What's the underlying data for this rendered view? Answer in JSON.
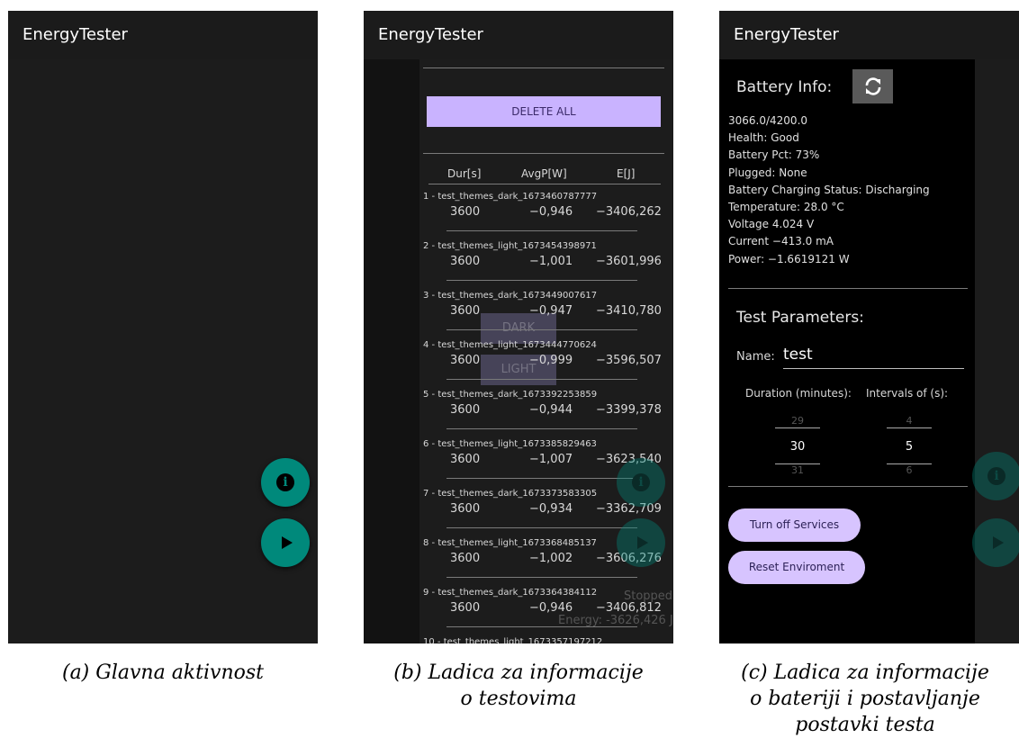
{
  "app": {
    "title": "EnergyTester"
  },
  "captions": {
    "a": [
      "(a) Glavna aktivnost"
    ],
    "b": [
      "(b) Ladica za informacije",
      "o testovima"
    ],
    "c": [
      "(c) Ladica za informacije",
      "o bateriji i postavljanje",
      "postavki testa"
    ]
  },
  "tests": {
    "delete_label": "DELETE ALL",
    "headers": [
      "Dur[s]",
      "AvgP[W]",
      "E[J]"
    ],
    "rows": [
      {
        "name": "1 - test_themes_dark_1673460787777",
        "dur": "3600",
        "avg": "−0,946",
        "e": "−3406,262"
      },
      {
        "name": "2 - test_themes_light_1673454398971",
        "dur": "3600",
        "avg": "−1,001",
        "e": "−3601,996"
      },
      {
        "name": "3 - test_themes_dark_1673449007617",
        "dur": "3600",
        "avg": "−0,947",
        "e": "−3410,780"
      },
      {
        "name": "4 - test_themes_light_1673444770624",
        "dur": "3600",
        "avg": "−0,999",
        "e": "−3596,507"
      },
      {
        "name": "5 - test_themes_dark_1673392253859",
        "dur": "3600",
        "avg": "−0,944",
        "e": "−3399,378"
      },
      {
        "name": "6 - test_themes_light_1673385829463",
        "dur": "3600",
        "avg": "−1,007",
        "e": "−3623,540"
      },
      {
        "name": "7 - test_themes_dark_1673373583305",
        "dur": "3600",
        "avg": "−0,934",
        "e": "−3362,709"
      },
      {
        "name": "8 - test_themes_light_1673368485137",
        "dur": "3600",
        "avg": "−1,002",
        "e": "−3606,276"
      },
      {
        "name": "9 - test_themes_dark_1673364384112",
        "dur": "3600",
        "avg": "−0,946",
        "e": "−3406,812"
      },
      {
        "name": "10 - test_themes_light_1673357197212",
        "dur": "",
        "avg": "",
        "e": ""
      }
    ],
    "dark_label": "DARK",
    "light_label": "LIGHT",
    "status_label": "Stopped",
    "energy_label": "Energy: -3626,426 J"
  },
  "battery": {
    "title": "Battery Info:",
    "lines": [
      "3066.0/4200.0",
      "Health: Good",
      "Battery Pct: 73%",
      "Plugged: None",
      "Battery Charging Status: Discharging",
      "Temperature: 28.0 °C",
      "Voltage 4.024 V",
      "Current −413.0 mA",
      "Power: −1.6619121 W"
    ]
  },
  "params": {
    "title": "Test Parameters:",
    "name_label": "Name:",
    "name_value": "test",
    "duration_label": "Duration (minutes):",
    "interval_label": "Intervals of (s):",
    "duration_prev": "29",
    "duration_value": "30",
    "duration_next": "31",
    "interval_prev": "4",
    "interval_value": "5",
    "interval_next": "6"
  },
  "buttons": {
    "turn_off": "Turn off Services",
    "reset": "Reset Enviroment"
  },
  "icons": {
    "fab_info": "info-icon",
    "fab_play": "play-icon",
    "refresh": "refresh-icon"
  },
  "colors": {
    "fab": "#00897b",
    "delete_button": "#c9b3ff",
    "pill_button": "#d7c4ff"
  }
}
